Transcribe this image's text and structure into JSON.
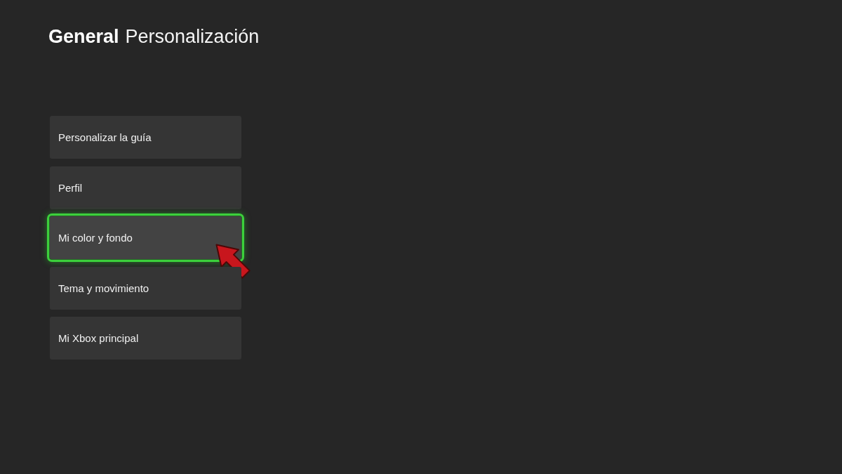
{
  "header": {
    "section": "General",
    "page": "Personalización"
  },
  "menu_items": [
    {
      "label": "Personalizar la guía",
      "selected": false
    },
    {
      "label": "Perfil",
      "selected": false
    },
    {
      "label": "Mi color y fondo",
      "selected": true
    },
    {
      "label": "Tema y movimiento",
      "selected": false
    },
    {
      "label": "Mi Xbox principal",
      "selected": false
    }
  ]
}
